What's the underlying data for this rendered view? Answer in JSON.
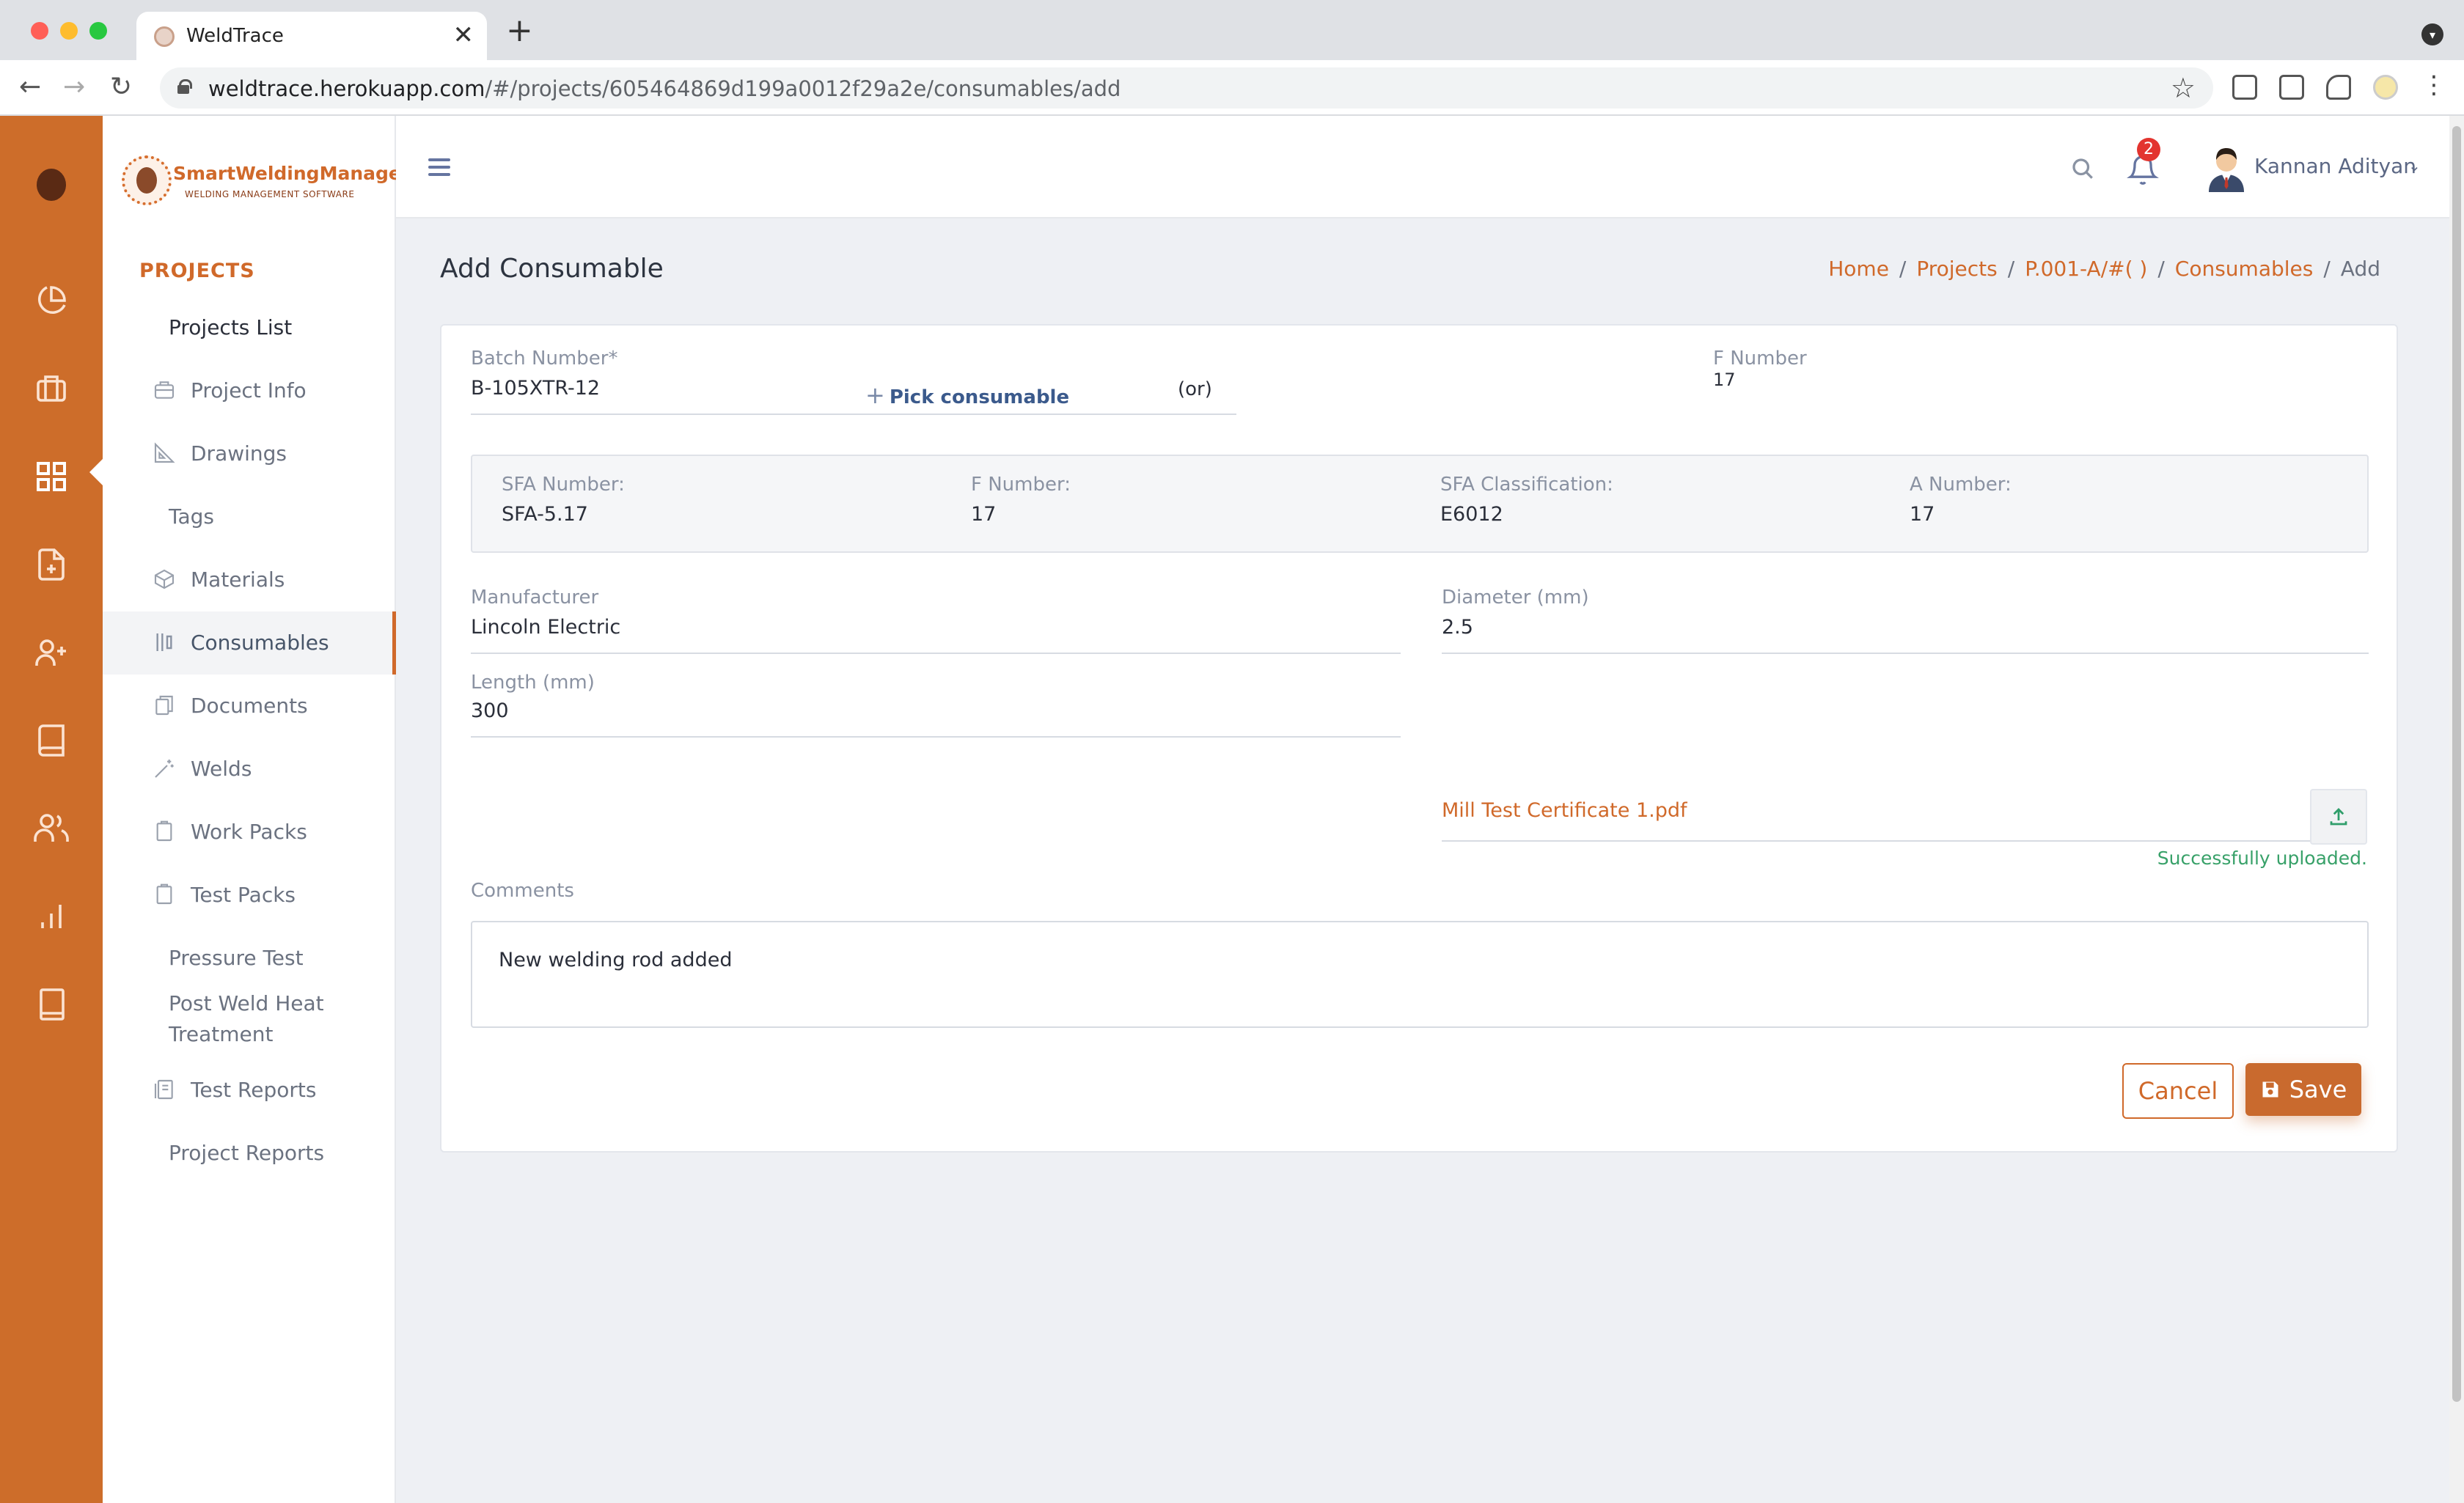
{
  "browser": {
    "tab_title": "WeldTrace",
    "url_host": "weldtrace.herokuapp.com",
    "url_path": "/#/projects/605464869d199a0012f29a2e/consumables/add",
    "new_tab_glyph": "+",
    "close_glyph": "✕"
  },
  "brand": {
    "name": "SmartWeldingManager",
    "tagline": "WELDING MANAGEMENT SOFTWARE",
    "accent": "#cd6d2a"
  },
  "rail": {
    "icons": [
      "avatar-icon",
      "pie-chart-icon",
      "briefcase-icon",
      "grid-icon",
      "file-plus-icon",
      "user-plus-icon",
      "book-icon",
      "users-icon",
      "bar-chart-icon",
      "book-closed-icon"
    ]
  },
  "sidebar": {
    "section_title": "PROJECTS",
    "items": [
      {
        "label": "Projects List",
        "icon": ""
      },
      {
        "label": "Project Info",
        "icon": "briefcase-icon"
      },
      {
        "label": "Drawings",
        "icon": "set-square-icon"
      },
      {
        "label": "Tags",
        "icon": ""
      },
      {
        "label": "Materials",
        "icon": "box-icon"
      },
      {
        "label": "Consumables",
        "icon": "rods-icon"
      },
      {
        "label": "Documents",
        "icon": "documents-icon"
      },
      {
        "label": "Welds",
        "icon": "wand-icon"
      },
      {
        "label": "Work Packs",
        "icon": "clipboard-icon"
      },
      {
        "label": "Test Packs",
        "icon": "clipboard-icon"
      },
      {
        "label": "Pressure Test",
        "icon": ""
      },
      {
        "label": "Post Weld Heat",
        "label2": "Treatment",
        "icon": ""
      },
      {
        "label": "Test Reports",
        "icon": "reports-icon"
      },
      {
        "label": "Project Reports",
        "icon": ""
      }
    ]
  },
  "header": {
    "notification_count": "2",
    "user_name": "Kannan Adityan",
    "caret": "⌄"
  },
  "page": {
    "title": "Add Consumable",
    "breadcrumb": [
      "Home",
      "Projects",
      "P.001-A/#( )",
      "Consumables",
      "Add"
    ],
    "breadcrumb_sep": "/"
  },
  "form": {
    "batch_number_label": "Batch Number*",
    "batch_number_value": "B-105XTR-12",
    "pick_plus": "+",
    "pick_label": "Pick consumable",
    "or_text": "(or)",
    "f_number_label": "F Number",
    "f_number_value": "17",
    "info": {
      "sfa_number_label": "SFA Number:",
      "sfa_number_value": "SFA-5.17",
      "f_number_label": "F Number:",
      "f_number_value": "17",
      "sfa_class_label": "SFA Classification:",
      "sfa_class_value": "E6012",
      "a_number_label": "A Number:",
      "a_number_value": "17"
    },
    "manufacturer_label": "Manufacturer",
    "manufacturer_value": "Lincoln Electric",
    "diameter_label": "Diameter (mm)",
    "diameter_value": "2.5",
    "length_label": "Length (mm)",
    "length_value": "300",
    "file_name": "Mill Test Certificate 1.pdf",
    "upload_status": "Successfully uploaded.",
    "comments_label": "Comments",
    "comments_value": "New welding rod added",
    "cancel_label": "Cancel",
    "save_label": "Save"
  }
}
